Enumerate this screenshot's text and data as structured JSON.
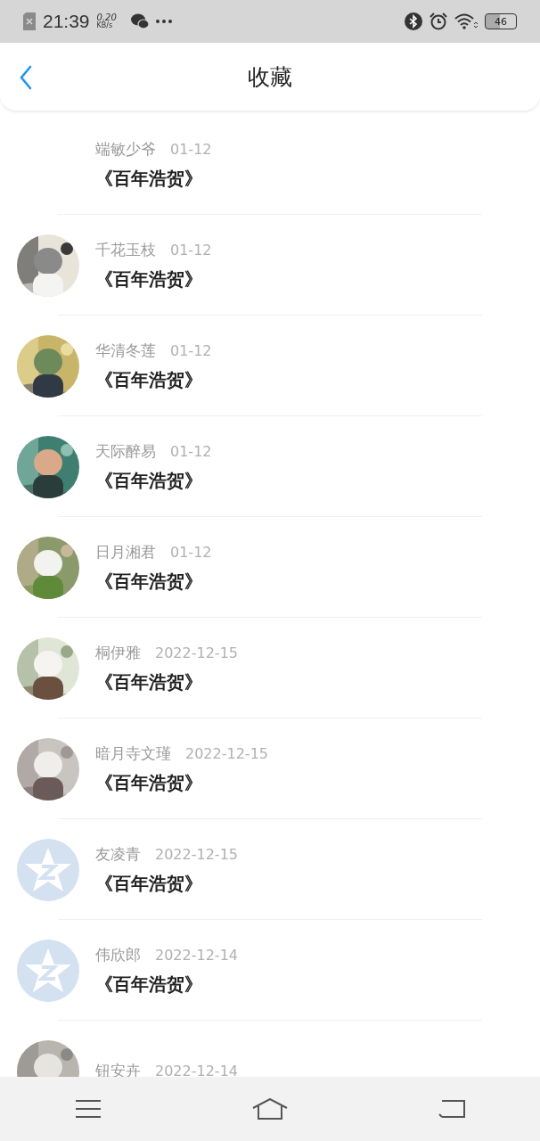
{
  "status_bar": {
    "time": "21:39",
    "speed": "0.20",
    "speed_unit": "KB/s",
    "battery": "46"
  },
  "header": {
    "title": "收藏"
  },
  "favorites": [
    {
      "kind": "plain",
      "name": "端敏少爷",
      "date": "01-12",
      "title": "《百年浩贺》"
    },
    {
      "kind": "picture",
      "name": "千花玉枝",
      "date": "01-12",
      "title": "《百年浩贺》"
    },
    {
      "kind": "picture",
      "name": "华清冬莲",
      "date": "01-12",
      "title": "《百年浩贺》"
    },
    {
      "kind": "picture",
      "name": "天际醉易",
      "date": "01-12",
      "title": "《百年浩贺》"
    },
    {
      "kind": "picture",
      "name": "日月湘君",
      "date": "01-12",
      "title": "《百年浩贺》"
    },
    {
      "kind": "picture",
      "name": "桐伊雅",
      "date": "2022-12-15",
      "title": "《百年浩贺》"
    },
    {
      "kind": "picture",
      "name": "暗月寺文瑾",
      "date": "2022-12-15",
      "title": "《百年浩贺》"
    },
    {
      "kind": "default",
      "name": "友凌青",
      "date": "2022-12-15",
      "title": "《百年浩贺》"
    },
    {
      "kind": "default",
      "name": "伟欣郎",
      "date": "2022-12-14",
      "title": "《百年浩贺》"
    },
    {
      "kind": "picture",
      "name": "钮安卉",
      "date": "2022-12-14"
    }
  ]
}
